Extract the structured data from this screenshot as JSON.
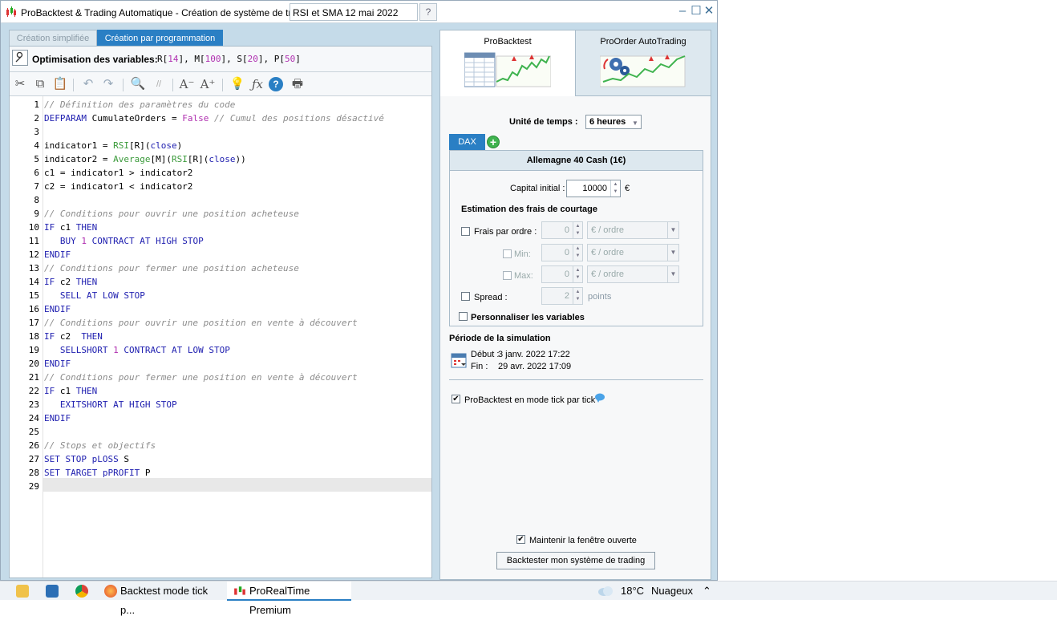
{
  "window": {
    "title": "ProBacktest & Trading Automatique - Création de système de trading",
    "name_field_value": "RSI et SMA 12 mai 2022"
  },
  "left_tabs": [
    "Création simplifiée",
    "Création par programmation"
  ],
  "optimisation": {
    "label": "Optimisation des variables:",
    "vars": "R[14], M[100], S[20], P[50]"
  },
  "code_lines": [
    "// Définition des paramètres du code",
    "DEFPARAM CumulateOrders = False // Cumul des positions désactivé",
    "",
    "indicator1 = RSI[R](close)",
    "indicator2 = Average[M](RSI[R](close))",
    "c1 = indicator1 > indicator2",
    "c2 = indicator1 < indicator2",
    "",
    "// Conditions pour ouvrir une position acheteuse",
    "IF c1 THEN",
    "   BUY 1 CONTRACT AT HIGH STOP",
    "ENDIF",
    "// Conditions pour fermer une position acheteuse",
    "IF c2 THEN",
    "   SELL AT LOW STOP",
    "ENDIF",
    "// Conditions pour ouvrir une position en vente à découvert",
    "IF c2  THEN",
    "   SELLSHORT 1 CONTRACT AT LOW STOP",
    "ENDIF",
    "// Conditions pour fermer une position en vente à découvert",
    "IF c1 THEN",
    "   EXITSHORT AT HIGH STOP",
    "ENDIF",
    "",
    "// Stops et objectifs",
    "SET STOP pLOSS S",
    "SET TARGET pPROFIT P",
    ""
  ],
  "line_numbers": [
    "1",
    "2",
    "3",
    "4",
    "5",
    "6",
    "7",
    "8",
    "9",
    "10",
    "11",
    "12",
    "13",
    "14",
    "15",
    "16",
    "17",
    "18",
    "19",
    "20",
    "21",
    "22",
    "23",
    "24",
    "25",
    "26",
    "27",
    "28",
    "29"
  ],
  "right_tabs": [
    "ProBacktest",
    "ProOrder AutoTrading"
  ],
  "backtest": {
    "timeframe_label": "Unité de temps :",
    "timeframe_value": "6 heures",
    "instrument_tab": "DAX",
    "instrument_name": "Allemagne 40 Cash (1€)",
    "capital_label": "Capital initial :",
    "capital_value": "10000",
    "capital_currency": "€",
    "fees_title": "Estimation des frais de courtage",
    "fee_per_order_label": "Frais par ordre :",
    "fee_per_order_value": "0",
    "fee_unit": "€ / ordre",
    "min_label": "Min:",
    "min_value": "0",
    "max_label": "Max:",
    "max_value": "0",
    "spread_label": "Spread :",
    "spread_value": "2",
    "spread_unit": "points",
    "custom_vars_label": "Personnaliser les variables",
    "period_title": "Période de la simulation",
    "start_label": "Début :",
    "start_value": "3 janv. 2022 17:22",
    "end_label": "Fin :",
    "end_value": "29 avr. 2022 17:09",
    "tick_mode_label": "ProBacktest en mode tick par tick",
    "tick_mode_checked": true,
    "keep_open_label": "Maintenir la fenêtre ouverte",
    "keep_open_checked": true,
    "run_button": "Backtester mon système de trading"
  },
  "taskbar": {
    "firefox_item": "Backtest mode tick p...",
    "prt_item": "ProRealTime Premium",
    "weather_temp": "18°C",
    "weather_desc": "Nuageux"
  },
  "colors": {
    "accent": "#2a7fc4",
    "keyword": "#2020b0",
    "comment": "#8c8c8c",
    "function": "#3a9a3a",
    "number": "#b030b0"
  }
}
